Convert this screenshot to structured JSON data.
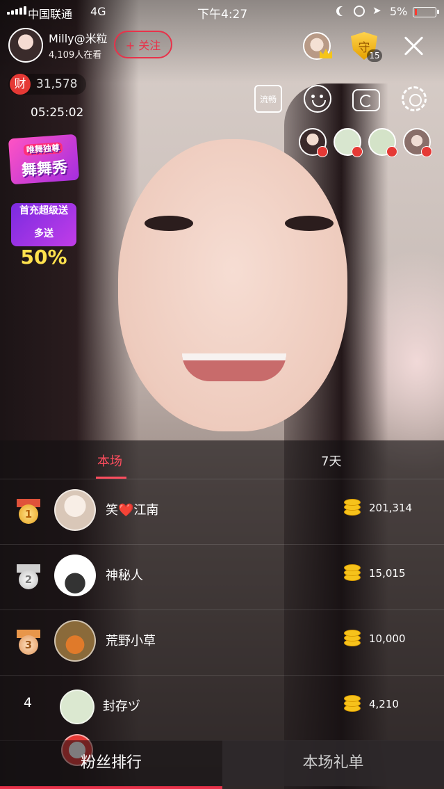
{
  "status_bar": {
    "carrier": "中国联通",
    "network": "4G",
    "time": "下午4:27",
    "battery": "5%"
  },
  "host": {
    "name": "Milly@米粒",
    "viewers": "4,109人在看",
    "follow_label": "+ 关注",
    "wealth_icon_label": "财",
    "wealth_value": "31,578",
    "live_duration": "05:25:02",
    "guard_icon_label": "守",
    "guard_count": "15"
  },
  "tools": {
    "smooth_label": "流畅"
  },
  "promos": {
    "dance_line1": "舞",
    "dance_line2": "唯舞独尊",
    "dance_line3": "舞秀",
    "recharge_line1": "首充超级送",
    "recharge_line2": "50%",
    "recharge_line3": "多送"
  },
  "ranking": {
    "tabs": [
      "本场",
      "7天"
    ],
    "active_tab": 0,
    "rows": [
      {
        "rank": "1",
        "name": "笑❤️江南",
        "value": "201,314",
        "medal": "gold"
      },
      {
        "rank": "2",
        "name": "神秘人",
        "value": "15,015",
        "medal": "silver"
      },
      {
        "rank": "3",
        "name": "荒野小草",
        "value": "10,000",
        "medal": "bronze"
      },
      {
        "rank": "4",
        "name": "封存ヅ",
        "value": "4,210",
        "medal": ""
      }
    ]
  },
  "bottom_tabs": {
    "fans_label": "粉丝排行",
    "gifts_label": "本场礼单"
  },
  "colors": {
    "accent": "#e8324a",
    "tab_active": "#ff4d5e",
    "coin": "#f6c21b"
  },
  "icons": [
    "signal-icon",
    "moon-icon",
    "lock-rotation-icon",
    "location-icon",
    "battery-icon",
    "crown-icon",
    "guard-shield-icon",
    "close-icon",
    "smooth-quality-icon",
    "beauty-face-icon",
    "camera-flip-icon",
    "settings-icon",
    "medal-icon",
    "coin-icon"
  ]
}
